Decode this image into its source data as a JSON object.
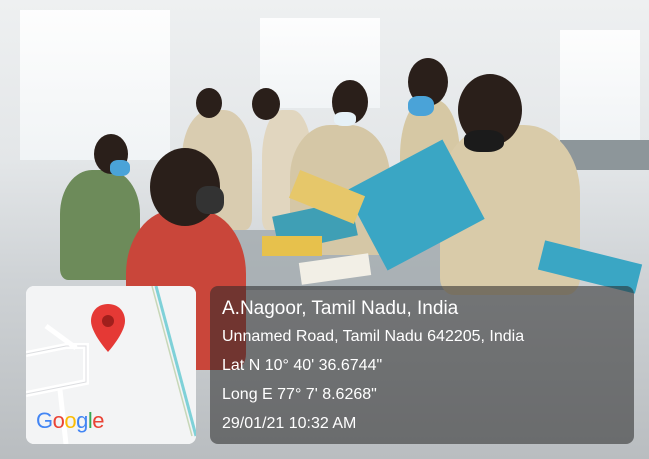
{
  "location": {
    "place": "A.Nagoor, Tamil Nadu, India",
    "address": "Unnamed Road, Tamil Nadu 642205, India",
    "latitude": "Lat N 10° 40' 36.6744\"",
    "longitude": "Long E 77° 7' 8.6268\"",
    "datetime": "29/01/21 10:32 AM"
  },
  "map": {
    "logo_letters": [
      "G",
      "o",
      "o",
      "g",
      "l",
      "e"
    ],
    "logo_colors": [
      "#4285F4",
      "#EA4335",
      "#FBBC05",
      "#4285F4",
      "#34A853",
      "#EA4335"
    ],
    "pin_color": "#E53935",
    "pin_icon": "map-pin-icon"
  },
  "photo": {
    "uniform_color": "#d8c9a8",
    "folder_color": "#3aa6c4",
    "saree_color": "#c9463a"
  }
}
